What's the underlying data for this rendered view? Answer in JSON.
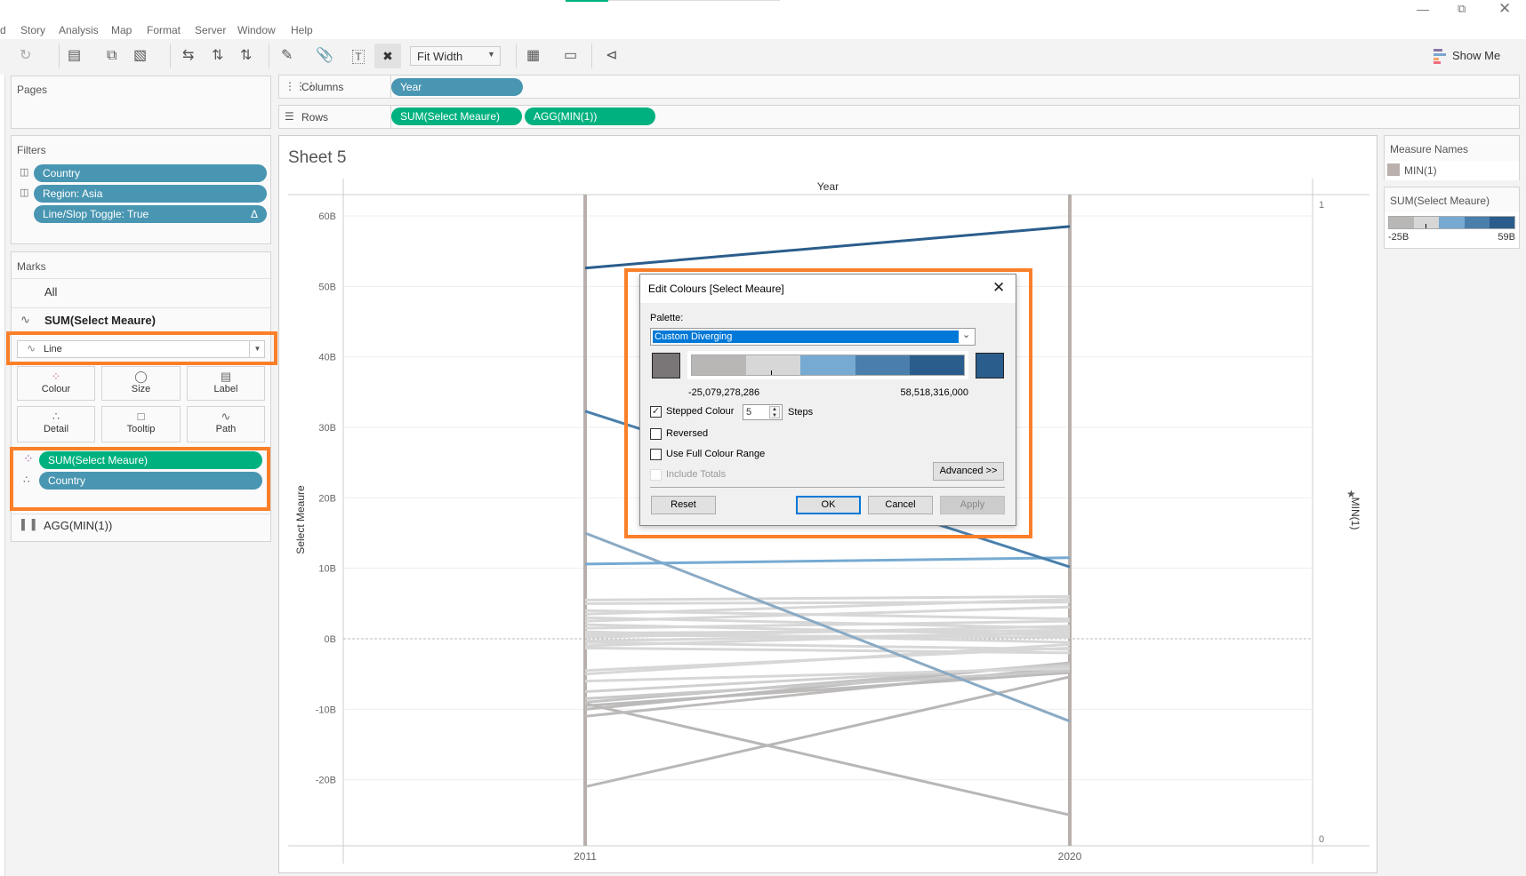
{
  "menu": [
    "d",
    "Story",
    "Analysis",
    "Map",
    "Format",
    "Server",
    "Window",
    "Help"
  ],
  "toolbar": {
    "fit_label": "Fit Width",
    "show_me": "Show Me"
  },
  "pages": {
    "title": "Pages"
  },
  "shelves": {
    "columns_label": "Columns",
    "rows_label": "Rows",
    "columns": [
      "Year"
    ],
    "rows": [
      "SUM(Select Meaure)",
      "AGG(MIN(1))"
    ]
  },
  "filters": {
    "title": "Filters",
    "items": [
      "Country",
      "Region: Asia",
      "Line/Slop Toggle: True"
    ]
  },
  "marks": {
    "title": "Marks",
    "all": "All",
    "active": "SUM(Select Meaure)",
    "mark_type": "Line",
    "cards": [
      "Colour",
      "Size",
      "Label",
      "Detail",
      "Tooltip",
      "Path"
    ],
    "fields": [
      "SUM(Select Meaure)",
      "Country"
    ],
    "secondary": "AGG(MIN(1))"
  },
  "sheet": {
    "title": "Sheet 5"
  },
  "legends": {
    "measure_names_title": "Measure Names",
    "measure_names_item": "MIN(1)",
    "color_title": "SUM(Select Meaure)",
    "color_min": "-25B",
    "color_max": "59B",
    "steps": [
      "#b9b6b6",
      "#d7d7d7",
      "#76aad2",
      "#4a7fac",
      "#2b5d8c"
    ]
  },
  "dialog": {
    "title": "Edit Colours [Select Meaure]",
    "palette_label": "Palette:",
    "palette_value": "Custom Diverging",
    "start_color": "#7a7577",
    "end_color": "#2b5d8c",
    "min_value": "-25,079,278,286",
    "max_value": "58,518,316,000",
    "stepped_label": "Stepped Colour",
    "stepped_checked": true,
    "steps_value": "5",
    "steps_label": "Steps",
    "reversed_label": "Reversed",
    "full_range_label": "Use Full Colour Range",
    "include_totals_label": "Include Totals",
    "advanced_label": "Advanced >>",
    "reset_label": "Reset",
    "ok_label": "OK",
    "cancel_label": "Cancel",
    "apply_label": "Apply"
  },
  "chart_data": {
    "type": "line",
    "xlabel": "Year",
    "ylabel": "Select Meaure",
    "y2label": "MIN(1)",
    "categories": [
      "2011",
      "2020"
    ],
    "yticks": [
      "60B",
      "50B",
      "40B",
      "30B",
      "20B",
      "10B",
      "0B",
      "-10B",
      "-20B"
    ],
    "ylim": [
      -30,
      63
    ],
    "y2ticks": [
      "1",
      "0"
    ],
    "grid": true,
    "series": [
      {
        "values": [
          52.6,
          58.5
        ],
        "color": "#2b5d8c"
      },
      {
        "values": [
          32.3,
          10.2
        ],
        "color": "#4a7fac"
      },
      {
        "values": [
          10.6,
          11.5
        ],
        "color": "#76aad2"
      },
      {
        "values": [
          15,
          -11.7
        ],
        "color": "#8aaac4"
      },
      {
        "values": [
          5.5,
          6
        ],
        "color": "#d7d7d7"
      },
      {
        "values": [
          5,
          5.2
        ],
        "color": "#d7d7d7"
      },
      {
        "values": [
          4,
          2.8
        ],
        "color": "#d7d7d7"
      },
      {
        "values": [
          3.5,
          5.6
        ],
        "color": "#d7d7d7"
      },
      {
        "values": [
          3,
          1.5
        ],
        "color": "#d7d7d7"
      },
      {
        "values": [
          2.5,
          4.5
        ],
        "color": "#d7d7d7"
      },
      {
        "values": [
          2,
          0.5
        ],
        "color": "#d7d7d7"
      },
      {
        "values": [
          1.5,
          2.5
        ],
        "color": "#d7d7d7"
      },
      {
        "values": [
          1,
          -0.5
        ],
        "color": "#d7d7d7"
      },
      {
        "values": [
          0.8,
          1.2
        ],
        "color": "#d7d7d7"
      },
      {
        "values": [
          0.5,
          0.2
        ],
        "color": "#d7d7d7"
      },
      {
        "values": [
          0.2,
          1.8
        ],
        "color": "#d7d7d7"
      },
      {
        "values": [
          -0.3,
          0.8
        ],
        "color": "#d7d7d7"
      },
      {
        "values": [
          -0.5,
          -1.5
        ],
        "color": "#d7d7d7"
      },
      {
        "values": [
          -1,
          1
        ],
        "color": "#d7d7d7"
      },
      {
        "values": [
          -1.3,
          -2
        ],
        "color": "#d7d7d7"
      },
      {
        "values": [
          -4.5,
          -1.3
        ],
        "color": "#d7d7d7"
      },
      {
        "values": [
          -5,
          -0.8
        ],
        "color": "#d7d7d7"
      },
      {
        "values": [
          -6,
          -4.2
        ],
        "color": "#d7d7d7"
      },
      {
        "values": [
          -7.5,
          -3.8
        ],
        "color": "#d0d0d0"
      },
      {
        "values": [
          -8.5,
          -4.5
        ],
        "color": "#c9c9c9"
      },
      {
        "values": [
          -9,
          -3.5
        ],
        "color": "#c4c4c4"
      },
      {
        "values": [
          -9.5,
          -4.8
        ],
        "color": "#bdbaba"
      },
      {
        "values": [
          -10,
          -3.4
        ],
        "color": "#bdbaba"
      },
      {
        "values": [
          -11,
          -4
        ],
        "color": "#bdbaba"
      },
      {
        "values": [
          -9.2,
          -25
        ],
        "color": "#b9b6b6"
      },
      {
        "values": [
          -21,
          -5.4
        ],
        "color": "#b9b6b6"
      }
    ]
  }
}
